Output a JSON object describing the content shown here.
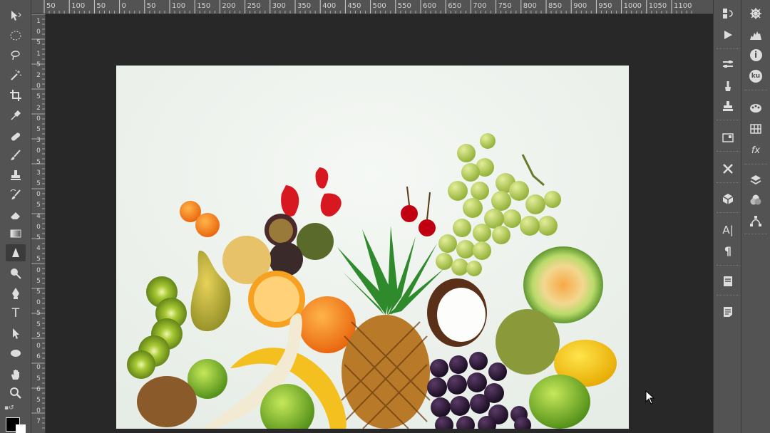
{
  "ruler_top_labels": [
    "50",
    "100",
    "50",
    "0",
    "50",
    "100",
    "150",
    "200",
    "250",
    "300",
    "350",
    "400",
    "450",
    "500",
    "550",
    "600",
    "650",
    "700",
    "750",
    "800",
    "850",
    "900",
    "950",
    "1000",
    "1050",
    "1100"
  ],
  "ruler_left_labels": [
    "1",
    "0",
    "5",
    "1",
    "5",
    "2",
    "0",
    "5",
    "2",
    "0",
    "5",
    "3",
    "0",
    "5",
    "3",
    "5",
    "0",
    "5",
    "4",
    "0",
    "5",
    "4",
    "5",
    "0",
    "5",
    "5",
    "0",
    "5",
    "5",
    "5",
    "0",
    "6",
    "0",
    "5",
    "6",
    "5",
    "0",
    "7"
  ],
  "toolbar": {
    "tools": [
      "move-tool",
      "marquee-tool",
      "lasso-tool",
      "magic-wand-tool",
      "crop-tool",
      "eyedropper-tool",
      "healing-brush-tool",
      "brush-tool",
      "clone-stamp-tool",
      "history-brush-tool",
      "eraser-tool",
      "gradient-tool",
      "sharpen-tool",
      "dodge-tool",
      "pen-tool",
      "type-tool",
      "path-selection-tool",
      "shape-tool",
      "hand-tool",
      "zoom-tool"
    ],
    "type_tool_glyph": "T",
    "foreground_color": "#000000",
    "background_color": "#ffffff"
  },
  "right_dock_1": {
    "type_panel_glyph": "A|",
    "paragraph_panel_glyph": "¶"
  },
  "right_dock_2": {
    "info_glyph": "i",
    "kuler_glyph": "ku",
    "fx_glyph": "fx"
  },
  "canvas": {
    "image_description": "fruit-arrangement-photo"
  }
}
